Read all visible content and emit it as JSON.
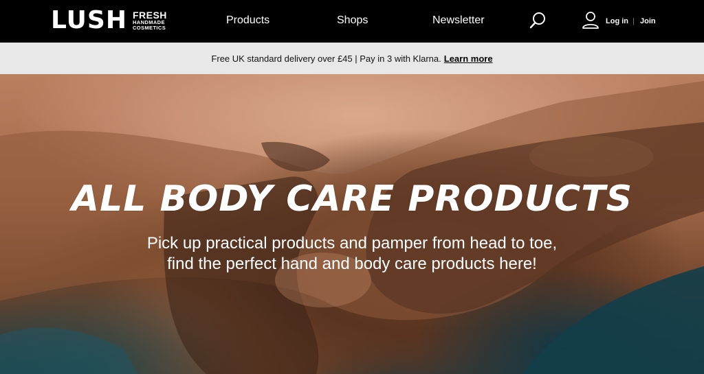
{
  "header": {
    "logo": {
      "word": "LUSH",
      "tagline": [
        "FRESH",
        "HANDMADE",
        "COSMETICS"
      ]
    },
    "nav": [
      {
        "label": "Products"
      },
      {
        "label": "Shops"
      },
      {
        "label": "Newsletter"
      }
    ],
    "search_icon": "search-icon",
    "account_icon": "user-icon",
    "login_label": "Log in",
    "separator": "|",
    "join_label": "Join"
  },
  "promo": {
    "text": "Free UK standard delivery over £45 | Pay in 3 with Klarna.",
    "link": "Learn more"
  },
  "hero": {
    "title": "ALL BODY CARE PRODUCTS",
    "subtitle_line1": "Pick up practical products and pamper from head to toe,",
    "subtitle_line2": "find the perfect hand and body care products here!"
  },
  "colors": {
    "header_bg": "#000000",
    "promo_bg": "#e8e8e8",
    "hero_text": "#ffffff"
  }
}
